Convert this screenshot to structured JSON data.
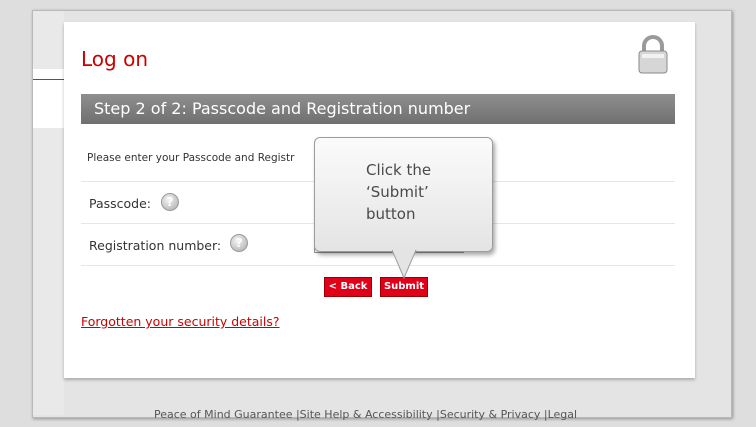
{
  "page": {
    "title": "Log on"
  },
  "step": {
    "header": "Step 2 of 2: Passcode and Registration number"
  },
  "form": {
    "instruction": "Please enter your Passcode and Registr",
    "passcode_label": "Passcode:",
    "registration_label": "Registration number:",
    "help_glyph": "?"
  },
  "buttons": {
    "back": "< Back",
    "submit": "Submit"
  },
  "links": {
    "forgotten": "Forgotten your security details?"
  },
  "callout": {
    "text": "Click the ‘Submit’ button"
  },
  "footer": {
    "links": "Peace of Mind Guarantee  |Site Help & Accessibility  |Security & Privacy  |Legal"
  },
  "colors": {
    "brand_red": "#cc0000",
    "button_red": "#e0001a",
    "header_grey": "#7f7f7f"
  },
  "icons": {
    "lock": "padlock-icon",
    "help": "help-icon"
  }
}
